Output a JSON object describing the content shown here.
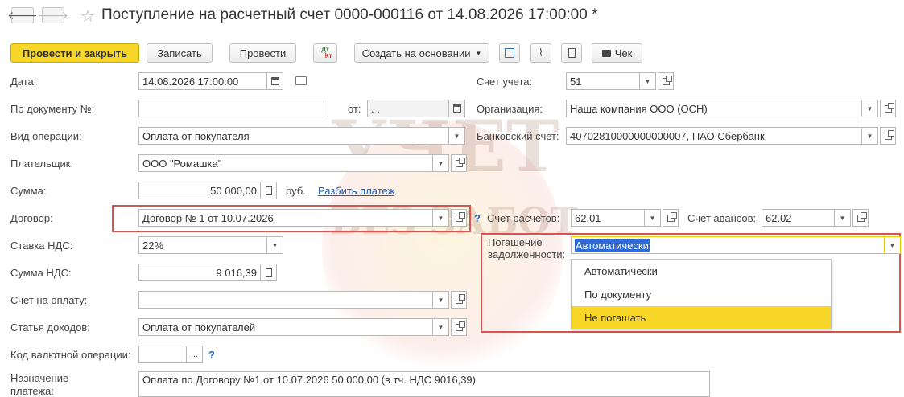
{
  "window": {
    "title": "Поступление на расчетный счет 0000-000116 от 14.08.2026 17:00:00 *",
    "back_glyph": "🡐",
    "forward_glyph": "🡒"
  },
  "toolbar": {
    "post_close": "Провести и закрыть",
    "save": "Записать",
    "post": "Провести",
    "dtkt_top": "Дт",
    "dtkt_bottom": "Кт",
    "create_based": "Создать на основании",
    "receipt": "Чек"
  },
  "form": {
    "date": {
      "label": "Дата:",
      "value": "14.08.2026 17:00:00"
    },
    "doc_no": {
      "label": "По документу №:",
      "value": "",
      "from_label": "от:",
      "from_value": " .  ."
    },
    "operation": {
      "label": "Вид операции:",
      "value": "Оплата от покупателя"
    },
    "payer": {
      "label": "Плательщик:",
      "value": "ООО \"Ромашка\""
    },
    "amount": {
      "label": "Сумма:",
      "value": "50 000,00",
      "currency": "руб.",
      "split_link": "Разбить платеж"
    },
    "contract": {
      "label": "Договор:",
      "value": "Договор № 1 от 10.07.2026",
      "help": "?"
    },
    "vat_rate": {
      "label": "Ставка НДС:",
      "value": "22%"
    },
    "vat_amount": {
      "label": "Сумма НДС:",
      "value": "9 016,39"
    },
    "invoice": {
      "label": "Счет на оплату:",
      "value": ""
    },
    "income_item": {
      "label": "Статья доходов:",
      "value": "Оплата от покупателей"
    },
    "currency_op": {
      "label": "Код валютной операции:",
      "value": "",
      "ellipsis": "...",
      "help": "?"
    },
    "purpose": {
      "label_line1": "Назначение",
      "label_line2": "платежа:",
      "value": "Оплата по Договору №1 от 10.07.2026 50 000,00 (в тч. НДС 9016,39)"
    },
    "account": {
      "label": "Счет учета:",
      "value": "51"
    },
    "organization": {
      "label": "Организация:",
      "value": "Наша компания ООО (ОСН)"
    },
    "bank_account": {
      "label": "Банковский счет:",
      "value": "40702810000000000007, ПАО Сбербанк"
    },
    "settlement_account": {
      "label": "Счет расчетов:",
      "value": "62.01"
    },
    "advance_account": {
      "label": "Счет авансов:",
      "value": "62.02"
    },
    "debt_repayment": {
      "label_line1": "Погашение",
      "label_line2": "задолженности:",
      "value": "Автоматически",
      "options": [
        "Автоматически",
        "По документу",
        "Не погашать"
      ],
      "highlighted": 2
    }
  },
  "watermark": {
    "line1": "УЧЕТ",
    "line2": "БЕЗ ЗАБОТ"
  },
  "colors": {
    "accent": "#f7d628",
    "highlight_box": "#d9534f",
    "link": "#1a5fb4"
  }
}
